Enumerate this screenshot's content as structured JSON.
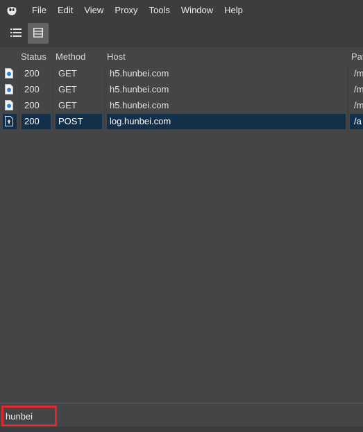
{
  "menubar": {
    "items": [
      "File",
      "Edit",
      "View",
      "Proxy",
      "Tools",
      "Window",
      "Help"
    ]
  },
  "toolbar": {
    "buttons": [
      {
        "name": "structure-view",
        "icon": "list-icon"
      },
      {
        "name": "sequence-view",
        "icon": "sequence-icon",
        "active": true
      }
    ]
  },
  "table": {
    "columns": [
      "",
      "Status",
      "Method",
      "Host",
      "Pat"
    ],
    "rows": [
      {
        "status": "200",
        "method": "GET",
        "host": "h5.hunbei.com",
        "path": "/m",
        "icon": "document-icon",
        "selected": false
      },
      {
        "status": "200",
        "method": "GET",
        "host": "h5.hunbei.com",
        "path": "/m",
        "icon": "document-icon",
        "selected": false
      },
      {
        "status": "200",
        "method": "GET",
        "host": "h5.hunbei.com",
        "path": "/m",
        "icon": "document-icon",
        "selected": false
      },
      {
        "status": "200",
        "method": "POST",
        "host": "log.hunbei.com",
        "path": "/a",
        "icon": "upload-document-icon",
        "selected": true
      }
    ]
  },
  "filter": {
    "value": "hunbei"
  },
  "colors": {
    "background": "#444546",
    "menubar": "#3c3d3e",
    "selection": "#12304a",
    "highlight_border": "#e5262b"
  }
}
